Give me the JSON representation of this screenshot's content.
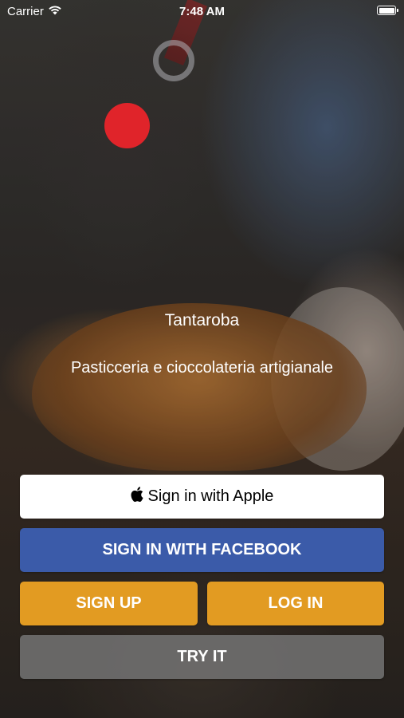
{
  "status_bar": {
    "carrier": "Carrier",
    "time": "7:48 AM",
    "icons": [
      "wifi-icon",
      "battery-icon"
    ]
  },
  "app": {
    "title": "Tantaroba",
    "subtitle": "Pasticceria e cioccolateria artigianale"
  },
  "buttons": {
    "apple_label": "Sign in with Apple",
    "facebook_label": "SIGN IN WITH FACEBOOK",
    "signup_label": "SIGN UP",
    "login_label": "LOG IN",
    "try_label": "TRY IT"
  },
  "colors": {
    "record_dot": "#e0242a",
    "facebook": "#3b5ba9",
    "accent": "#e29b22",
    "try_button": "#767676"
  }
}
